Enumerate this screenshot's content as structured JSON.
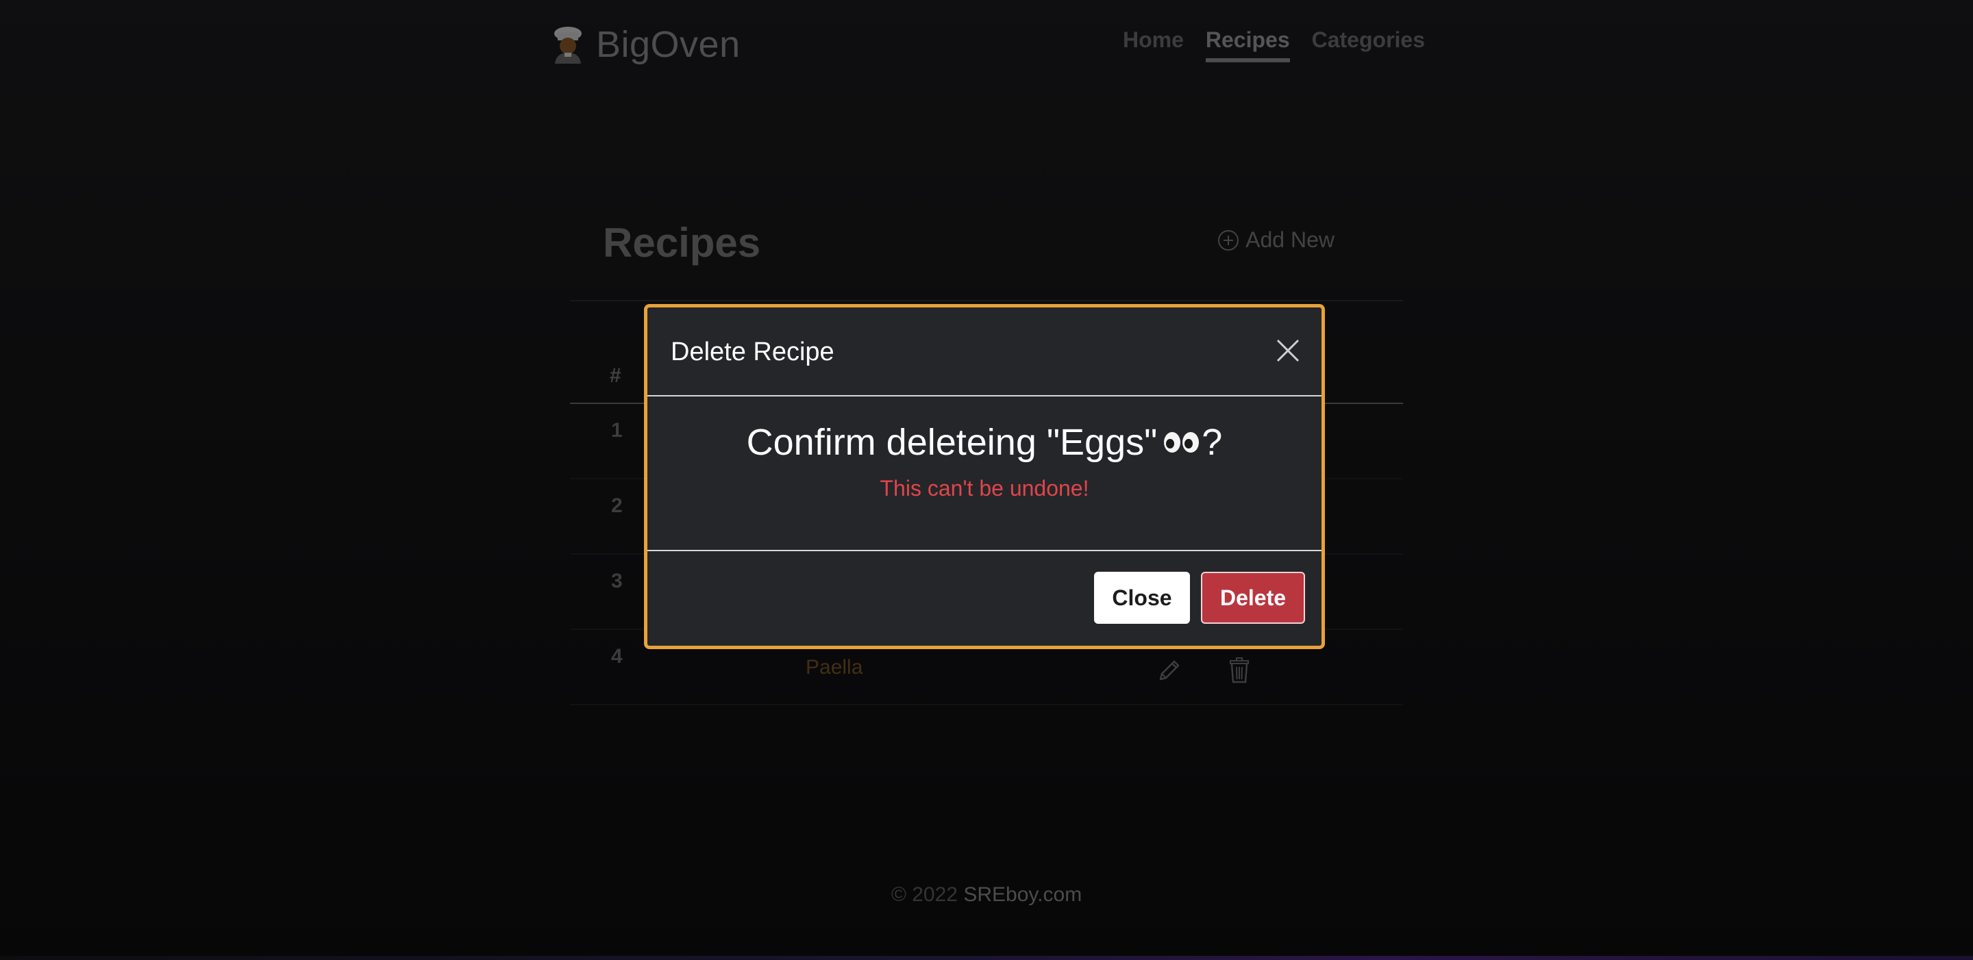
{
  "brand": {
    "name": "BigOven",
    "icon": "chef-icon"
  },
  "nav": {
    "items": [
      {
        "label": "Home",
        "active": false
      },
      {
        "label": "Recipes",
        "active": true
      },
      {
        "label": "Categories",
        "active": false
      }
    ]
  },
  "page": {
    "title": "Recipes",
    "add_new_label": "Add New",
    "table": {
      "hash_header": "#",
      "rows": [
        {
          "num": "1",
          "name": ""
        },
        {
          "num": "2",
          "name": ""
        },
        {
          "num": "3",
          "name": ""
        },
        {
          "num": "4",
          "name": "Paella"
        }
      ]
    }
  },
  "modal": {
    "title": "Delete Recipe",
    "confirm_text": "Confirm deleteing \"Eggs\"",
    "confirm_suffix": "?",
    "warning": "This can't be undone!",
    "close_label": "Close",
    "delete_label": "Delete",
    "accent_color": "#e8a23a",
    "danger_color": "#b9363f"
  },
  "footer": {
    "copyright": "© 2022",
    "site": "SREboy.com"
  }
}
